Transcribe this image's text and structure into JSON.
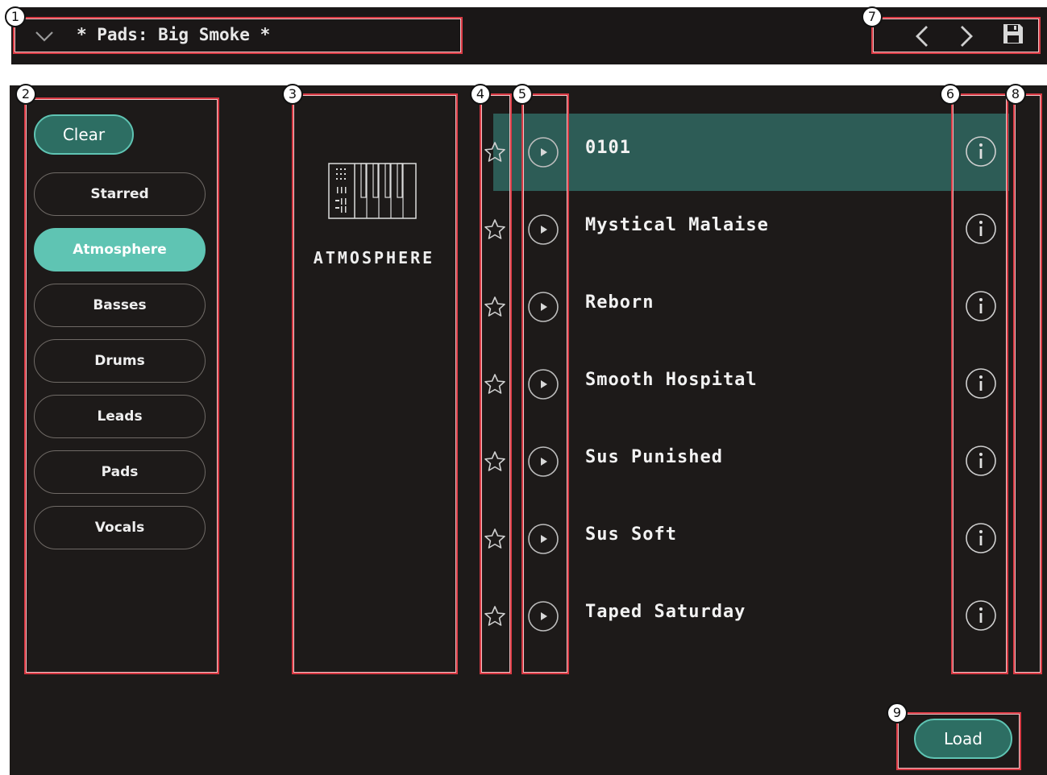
{
  "header": {
    "preset_title": "* Pads: Big Smoke *",
    "icons": [
      "chevron-down-icon",
      "chevron-left-icon",
      "chevron-right-icon",
      "save-icon"
    ]
  },
  "sidebar": {
    "clear_label": "Clear",
    "categories": [
      {
        "label": "Starred",
        "active": false
      },
      {
        "label": "Atmosphere",
        "active": true
      },
      {
        "label": "Basses",
        "active": false
      },
      {
        "label": "Drums",
        "active": false
      },
      {
        "label": "Leads",
        "active": false
      },
      {
        "label": "Pads",
        "active": false
      },
      {
        "label": "Vocals",
        "active": false
      }
    ]
  },
  "category_panel": {
    "name": "ATMOSPHERE",
    "icon": "keyboard-icon"
  },
  "presets": [
    {
      "name": "0101",
      "selected": true
    },
    {
      "name": "Mystical Malaise",
      "selected": false
    },
    {
      "name": "Reborn",
      "selected": false
    },
    {
      "name": "Smooth Hospital",
      "selected": false
    },
    {
      "name": "Sus Punished",
      "selected": false
    },
    {
      "name": "Sus Soft",
      "selected": false
    },
    {
      "name": "Taped Saturday",
      "selected": false
    }
  ],
  "footer": {
    "load_label": "Load"
  },
  "callouts": [
    "1",
    "2",
    "3",
    "4",
    "5",
    "6",
    "7",
    "8",
    "9"
  ],
  "colors": {
    "accent": "#5fc4b3",
    "accent_dark": "#2d6e63",
    "selected_row": "#2d5c56",
    "background": "#1d1a19",
    "highlight_box": "#d83a44"
  }
}
